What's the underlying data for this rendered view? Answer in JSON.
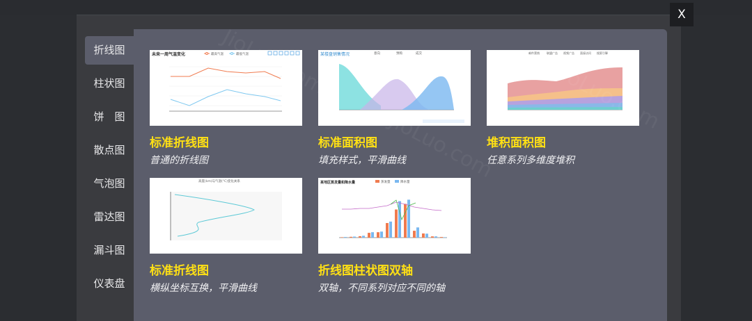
{
  "close_label": "X",
  "sidebar": {
    "items": [
      {
        "label": "折线图"
      },
      {
        "label": "柱状图"
      },
      {
        "label": "饼　图"
      },
      {
        "label": "散点图"
      },
      {
        "label": "气泡图"
      },
      {
        "label": "雷达图"
      },
      {
        "label": "漏斗图"
      },
      {
        "label": "仪表盘"
      }
    ]
  },
  "cards": [
    {
      "title": "标准折线图",
      "subtitle": "普通的折线图",
      "thumb_title": "未来一周气温变化",
      "legend": [
        "最高气温",
        "最低气温"
      ]
    },
    {
      "title": "标准面积图",
      "subtitle": "填充样式，平滑曲线",
      "thumb_title": "某楼盘销售情况",
      "legend": [
        "意向",
        "预购",
        "成交"
      ]
    },
    {
      "title": "堆积面积图",
      "subtitle": "任意系列多维度堆积",
      "legend": [
        "邮件营销",
        "联盟广告",
        "视频广告",
        "直接访问",
        "搜索引擎"
      ]
    },
    {
      "title": "标准折线图",
      "subtitle": "横纵坐标互换，平滑曲线",
      "legend": [
        "高度(km)与气温(°C)变化关系"
      ]
    },
    {
      "title": "折线图柱状图双轴",
      "subtitle": "双轴，不同系列对应不同的轴",
      "thumb_title": "某地区蒸发量和降水量",
      "legend": [
        "蒸发量",
        "降水量"
      ]
    }
  ],
  "watermark": "JioLuo.com",
  "colors": {
    "accent_title": "#ffe014",
    "panel": "#5b5d6b",
    "modal": "#3a3b3f",
    "background": "#2b2d31"
  }
}
